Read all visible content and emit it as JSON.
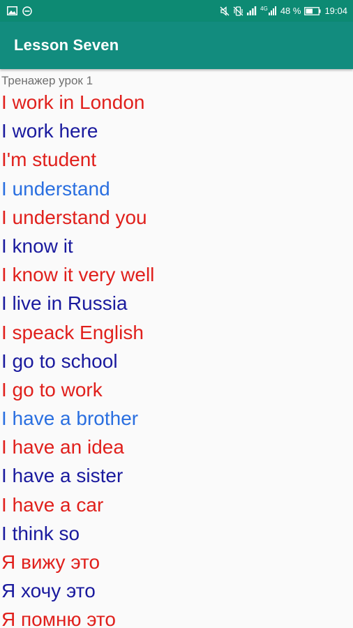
{
  "status_bar": {
    "battery_percent": "48 %",
    "time": "19:04",
    "network_label": "4G",
    "icon_color": "#ffffff",
    "background": "#0d8a73",
    "left_icons": [
      "gallery-icon",
      "minus-circle-icon"
    ],
    "right_icons": [
      "mute-icon",
      "vibrate-icon",
      "signal-icon",
      "lte-signal-icon",
      "battery-icon"
    ]
  },
  "app_bar": {
    "title": "Lesson Seven",
    "background": "#128c7e"
  },
  "content": {
    "subtitle": "Тренажер урок 1",
    "colors": {
      "red": "#e0201c",
      "dark_blue": "#1a1a9e",
      "light_blue": "#2a6fe0"
    },
    "phrases": [
      {
        "text": "I work in London",
        "color": "#e0201c"
      },
      {
        "text": "I work here",
        "color": "#1a1a9e"
      },
      {
        "text": "I'm student",
        "color": "#e0201c"
      },
      {
        "text": "I understand",
        "color": "#2a6fe0"
      },
      {
        "text": "I understand you",
        "color": "#e0201c"
      },
      {
        "text": "I know it",
        "color": "#1a1a9e"
      },
      {
        "text": "I know it very well",
        "color": "#e0201c"
      },
      {
        "text": "I live in Russia",
        "color": "#1a1a9e"
      },
      {
        "text": "I speack English",
        "color": "#e0201c"
      },
      {
        "text": "I go to school",
        "color": "#1a1a9e"
      },
      {
        "text": "I go to work",
        "color": "#e0201c"
      },
      {
        "text": "I have a brother",
        "color": "#2a6fe0"
      },
      {
        "text": "I have an idea",
        "color": "#e0201c"
      },
      {
        "text": "I have a sister",
        "color": "#1a1a9e"
      },
      {
        "text": "I have a car",
        "color": "#e0201c"
      },
      {
        "text": "I think so",
        "color": "#1a1a9e"
      },
      {
        "text": "Я вижу это",
        "color": "#e0201c"
      },
      {
        "text": "Я хочу это",
        "color": "#1a1a9e"
      },
      {
        "text": "Я помню это",
        "color": "#e0201c"
      }
    ]
  }
}
